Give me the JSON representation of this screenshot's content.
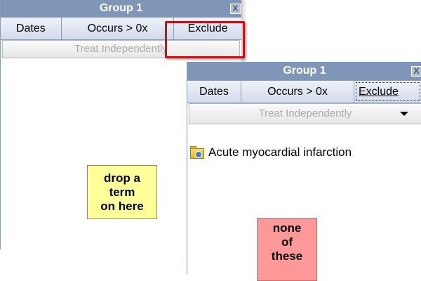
{
  "panel_back": {
    "title": "Group 1",
    "close_label": "X",
    "tabs": [
      "Dates",
      "Occurs > 0x",
      "Exclude"
    ],
    "select_value": "Treat Independently",
    "drop_text": "drop a\nterm\non here"
  },
  "panel_front": {
    "title": "Group 1",
    "close_label": "X",
    "tabs": [
      "Dates",
      "Occurs > 0x",
      "Exclude"
    ],
    "select_value": "Treat Independently",
    "term": "Acute myocardial infarction",
    "term_icon": "folder-icon",
    "drop_text": "none\nof\nthese"
  },
  "colors": {
    "titlebar": "#8096b8",
    "highlight": "#c0141c",
    "drop_yellow": "#ffff99",
    "drop_red": "#ff9999"
  }
}
